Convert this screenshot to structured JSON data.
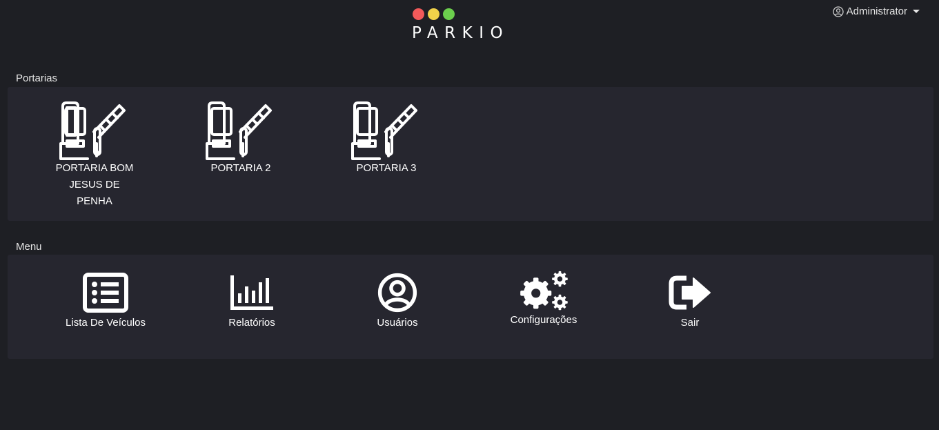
{
  "header": {
    "brand": "PARKIO",
    "dot_colors": [
      "#f25a5a",
      "#f1d24a",
      "#6ccf4d"
    ],
    "user_label": "Administrator",
    "user_icon": "user-circle-icon"
  },
  "portarias": {
    "title": "Portarias",
    "items": [
      {
        "label": "PORTARIA BOM JESUS DE PENHA",
        "icon": "parking-gate-icon"
      },
      {
        "label": "PORTARIA 2",
        "icon": "parking-gate-icon"
      },
      {
        "label": "PORTARIA 3",
        "icon": "parking-gate-icon"
      }
    ]
  },
  "menu": {
    "title": "Menu",
    "items": [
      {
        "label": "Lista De Veículos",
        "icon": "list-icon"
      },
      {
        "label": "Relatórios",
        "icon": "bar-chart-icon"
      },
      {
        "label": "Usuários",
        "icon": "user-circle-icon"
      },
      {
        "label": "Configurações",
        "icon": "gears-icon"
      },
      {
        "label": "Sair",
        "icon": "sign-out-icon"
      }
    ]
  }
}
